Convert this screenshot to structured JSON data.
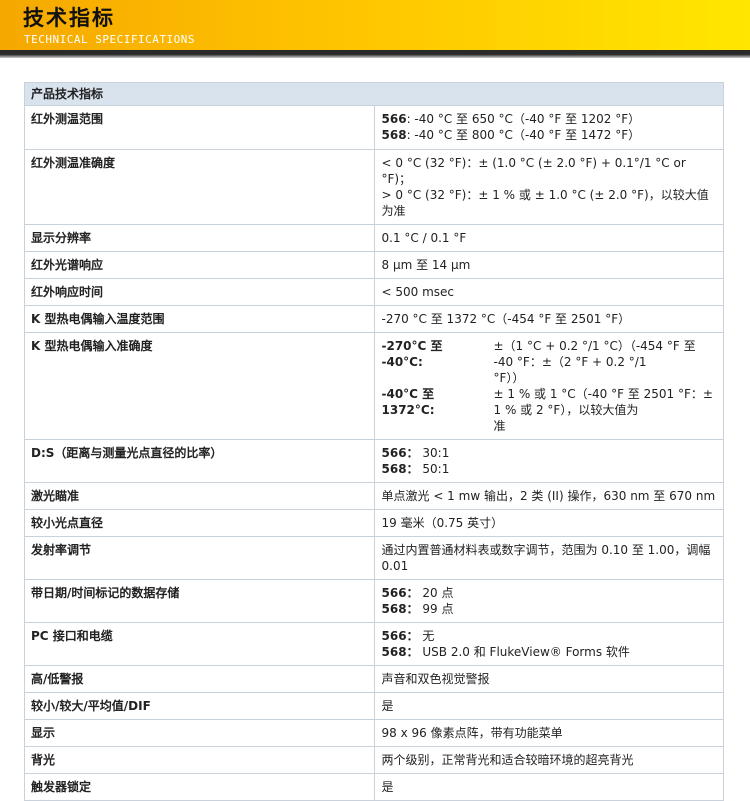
{
  "banner": {
    "title": "技术指标",
    "subtitle": "TECHNICAL SPECIFICATIONS"
  },
  "table": {
    "header": "产品技术指标",
    "rows": {
      "ir_range": {
        "label": "红外测温范围",
        "l1_model": "566",
        "l1_text": ": -40 °C 至 650 °C（-40 °F 至 1202 °F）",
        "l2_model": "568",
        "l2_text": ": -40 °C 至 800 °C（-40 °F 至 1472 °F）"
      },
      "ir_accuracy": {
        "label": "红外测温准确度",
        "l1": "< 0 °C (32 °F)：± (1.0 °C (± 2.0 °F) + 0.1°/1 °C or °F)；",
        "l2": "> 0 °C (32 °F)：± 1 % 或 ± 1.0 °C (± 2.0 °F)，以较大值为准"
      },
      "display_resolution": {
        "label": "显示分辨率",
        "value": "0.1 °C / 0.1 °F"
      },
      "spectral_response": {
        "label": "红外光谱响应",
        "value": "8 μm 至 14 μm"
      },
      "response_time": {
        "label": "红外响应时间",
        "value": "< 500 msec"
      },
      "tc_range": {
        "label": "K 型热电偶输入温度范围",
        "value": "-270 °C 至 1372 °C（-454 °F 至 2501 °F）"
      },
      "tc_accuracy": {
        "label": "K 型热电偶输入准确度",
        "r1_left_a": "-270°C 至",
        "r1_left_b": "-40°C:",
        "r1_right_a": "±（1 °C + 0.2 °/1 °C）（-454 °F 至 -40 °F：±（2 °F + 0.2 °/1",
        "r1_right_b": "°F））",
        "r2_left_a": "-40°C 至",
        "r2_left_b": "1372°C:",
        "r2_right_a": "± 1 % 或 1 °C（-40 °F 至 2501 °F：± 1 % 或 2 °F），以较大值为",
        "r2_right_b": "准"
      },
      "ds_ratio": {
        "label": "D:S（距离与测量光点直径的比率）",
        "l1_model": "566：",
        "l1_value": "30:1",
        "l2_model": "568：",
        "l2_value": "50:1"
      },
      "laser": {
        "label": "激光瞄准",
        "value": "单点激光 < 1 mw 输出，2 类 (II) 操作，630 nm 至 670 nm"
      },
      "min_spot": {
        "label": "较小光点直径",
        "value": "19 毫米（0.75 英寸）"
      },
      "emissivity": {
        "label": "发射率调节",
        "value": "通过内置普通材料表或数字调节，范围为 0.10 至 1.00，调幅 0.01"
      },
      "data_storage": {
        "label": "带日期/时间标记的数据存储",
        "l1_model": "566：",
        "l1_value": "20 点",
        "l2_model": "568：",
        "l2_value": "99 点"
      },
      "pc_interface": {
        "label": "PC 接口和电缆",
        "l1_model": "566：",
        "l1_value": "无",
        "l2_model": "568：",
        "l2_value": "USB 2.0 和 FlukeView® Forms 软件"
      },
      "alarm": {
        "label": "高/低警报",
        "value": "声音和双色视觉警报"
      },
      "min_max": {
        "label": "较小/较大/平均值/DIF",
        "value": "是"
      },
      "display": {
        "label": "显示",
        "value": "98 x 96 像素点阵，带有功能菜单"
      },
      "backlight": {
        "label": "背光",
        "value": "两个级别，正常背光和适合较暗环境的超亮背光"
      },
      "trigger_lock": {
        "label": "触发器锁定",
        "value": "是"
      }
    }
  }
}
